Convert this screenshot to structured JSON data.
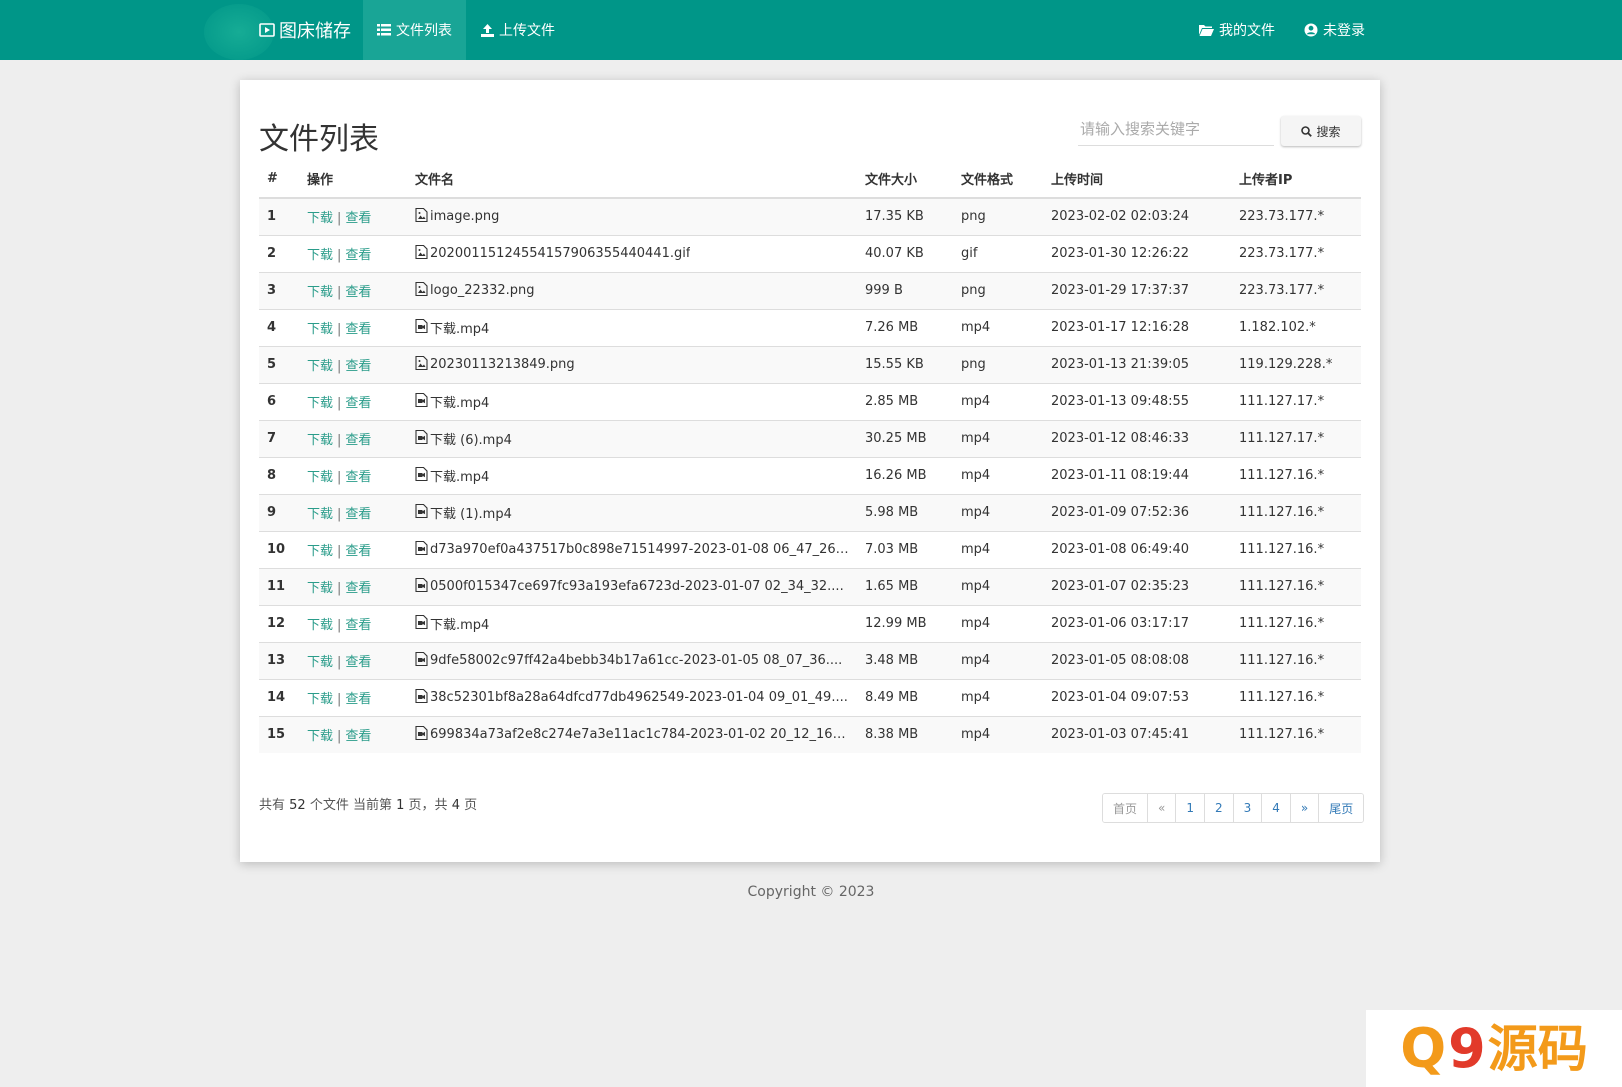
{
  "navbar": {
    "brand": "图床储存",
    "items": [
      {
        "label": "文件列表",
        "active": true
      },
      {
        "label": "上传文件",
        "active": false
      }
    ],
    "right_items": [
      {
        "label": "我的文件"
      },
      {
        "label": "未登录"
      }
    ],
    "color": "#009688"
  },
  "main": {
    "title": "文件列表",
    "search": {
      "placeholder": "请输入搜索关键字",
      "value": "",
      "button": "搜索"
    },
    "table": {
      "headers": [
        "#",
        "操作",
        "文件名",
        "文件大小",
        "文件格式",
        "上传时间",
        "上传者IP"
      ],
      "action_download": "下载",
      "action_separator": "|",
      "action_view": "查看",
      "rows": [
        {
          "num": "1",
          "name": "image.png",
          "size": "17.35 KB",
          "format": "png",
          "time": "2023-02-02 02:03:24",
          "ip": "223.73.177.*",
          "icon": "image-file-icon"
        },
        {
          "num": "2",
          "name": "20200115124554157906355440441.gif",
          "size": "40.07 KB",
          "format": "gif",
          "time": "2023-01-30 12:26:22",
          "ip": "223.73.177.*",
          "icon": "image-file-icon"
        },
        {
          "num": "3",
          "name": "logo_22332.png",
          "size": "999 B",
          "format": "png",
          "time": "2023-01-29 17:37:37",
          "ip": "223.73.177.*",
          "icon": "image-file-icon"
        },
        {
          "num": "4",
          "name": "下载.mp4",
          "size": "7.26 MB",
          "format": "mp4",
          "time": "2023-01-17 12:16:28",
          "ip": "1.182.102.*",
          "icon": "video-file-icon"
        },
        {
          "num": "5",
          "name": "20230113213849.png",
          "size": "15.55 KB",
          "format": "png",
          "time": "2023-01-13 21:39:05",
          "ip": "119.129.228.*",
          "icon": "image-file-icon"
        },
        {
          "num": "6",
          "name": "下载.mp4",
          "size": "2.85 MB",
          "format": "mp4",
          "time": "2023-01-13 09:48:55",
          "ip": "111.127.17.*",
          "icon": "video-file-icon"
        },
        {
          "num": "7",
          "name": "下载 (6).mp4",
          "size": "30.25 MB",
          "format": "mp4",
          "time": "2023-01-12 08:46:33",
          "ip": "111.127.17.*",
          "icon": "video-file-icon"
        },
        {
          "num": "8",
          "name": "下载.mp4",
          "size": "16.26 MB",
          "format": "mp4",
          "time": "2023-01-11 08:19:44",
          "ip": "111.127.16.*",
          "icon": "video-file-icon"
        },
        {
          "num": "9",
          "name": "下载 (1).mp4",
          "size": "5.98 MB",
          "format": "mp4",
          "time": "2023-01-09 07:52:36",
          "ip": "111.127.16.*",
          "icon": "video-file-icon"
        },
        {
          "num": "10",
          "name": "d73a970ef0a437517b0c898e71514997-2023-01-08 06_47_26....",
          "size": "7.03 MB",
          "format": "mp4",
          "time": "2023-01-08 06:49:40",
          "ip": "111.127.16.*",
          "icon": "video-file-icon"
        },
        {
          "num": "11",
          "name": "0500f015347ce697fc93a193efa6723d-2023-01-07 02_34_32....",
          "size": "1.65 MB",
          "format": "mp4",
          "time": "2023-01-07 02:35:23",
          "ip": "111.127.16.*",
          "icon": "video-file-icon"
        },
        {
          "num": "12",
          "name": "下载.mp4",
          "size": "12.99 MB",
          "format": "mp4",
          "time": "2023-01-06 03:17:17",
          "ip": "111.127.16.*",
          "icon": "video-file-icon"
        },
        {
          "num": "13",
          "name": "9dfe58002c97ff42a4bebb34b17a61cc-2023-01-05 08_07_36....",
          "size": "3.48 MB",
          "format": "mp4",
          "time": "2023-01-05 08:08:08",
          "ip": "111.127.16.*",
          "icon": "video-file-icon"
        },
        {
          "num": "14",
          "name": "38c52301bf8a28a64dfcd77db4962549-2023-01-04 09_01_49....",
          "size": "8.49 MB",
          "format": "mp4",
          "time": "2023-01-04 09:07:53",
          "ip": "111.127.16.*",
          "icon": "video-file-icon"
        },
        {
          "num": "15",
          "name": "699834a73af2e8c274e7a3e11ac1c784-2023-01-02 20_12_16....",
          "size": "8.38 MB",
          "format": "mp4",
          "time": "2023-01-03 07:45:41",
          "ip": "111.127.16.*",
          "icon": "video-file-icon"
        }
      ]
    },
    "summary": {
      "prefix": "共有",
      "total": "52",
      "mid": "个文件  当前第",
      "current": "1",
      "mid2": "页，共",
      "pages": "4",
      "suffix": "页"
    },
    "pagination": [
      "首页",
      "«",
      "1",
      "2",
      "3",
      "4",
      "»",
      "尾页"
    ]
  },
  "footer": {
    "copyright": "Copyright © 2023"
  },
  "watermark": {
    "q": "Q",
    "nine": "9",
    "text": "源码"
  },
  "colors": {
    "accent": "#009688",
    "link": "#2a9c8a",
    "format": "#1a1ab0",
    "page_link": "#337ab7"
  }
}
